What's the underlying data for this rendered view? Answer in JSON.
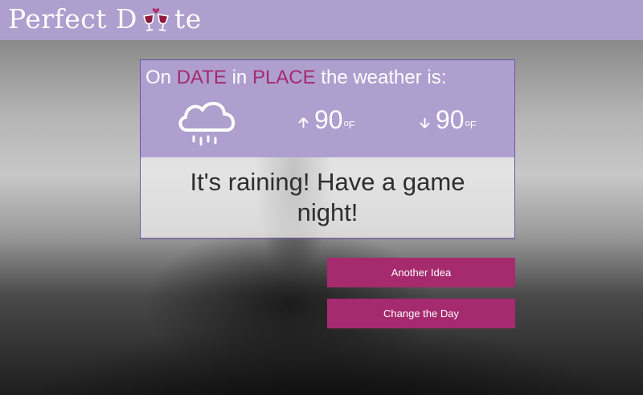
{
  "header": {
    "logo_part1": "Perfect D",
    "logo_part2": "te",
    "logo_icon": "wine-glasses-heart-icon",
    "bg_color": "#ae9fcf"
  },
  "weather": {
    "prefix": "On ",
    "date": "DATE",
    "mid": " in ",
    "place": "PLACE",
    "suffix": " the weather is:",
    "condition_icon": "rain-cloud-icon",
    "high": "90",
    "low": "90",
    "unit": "F",
    "degree": "o",
    "highlight_color": "#a52a6e"
  },
  "idea": {
    "text": "It's raining! Have a game night!"
  },
  "buttons": {
    "another_idea": "Another Idea",
    "change_day": "Change the Day",
    "color": "#a52a6e"
  }
}
